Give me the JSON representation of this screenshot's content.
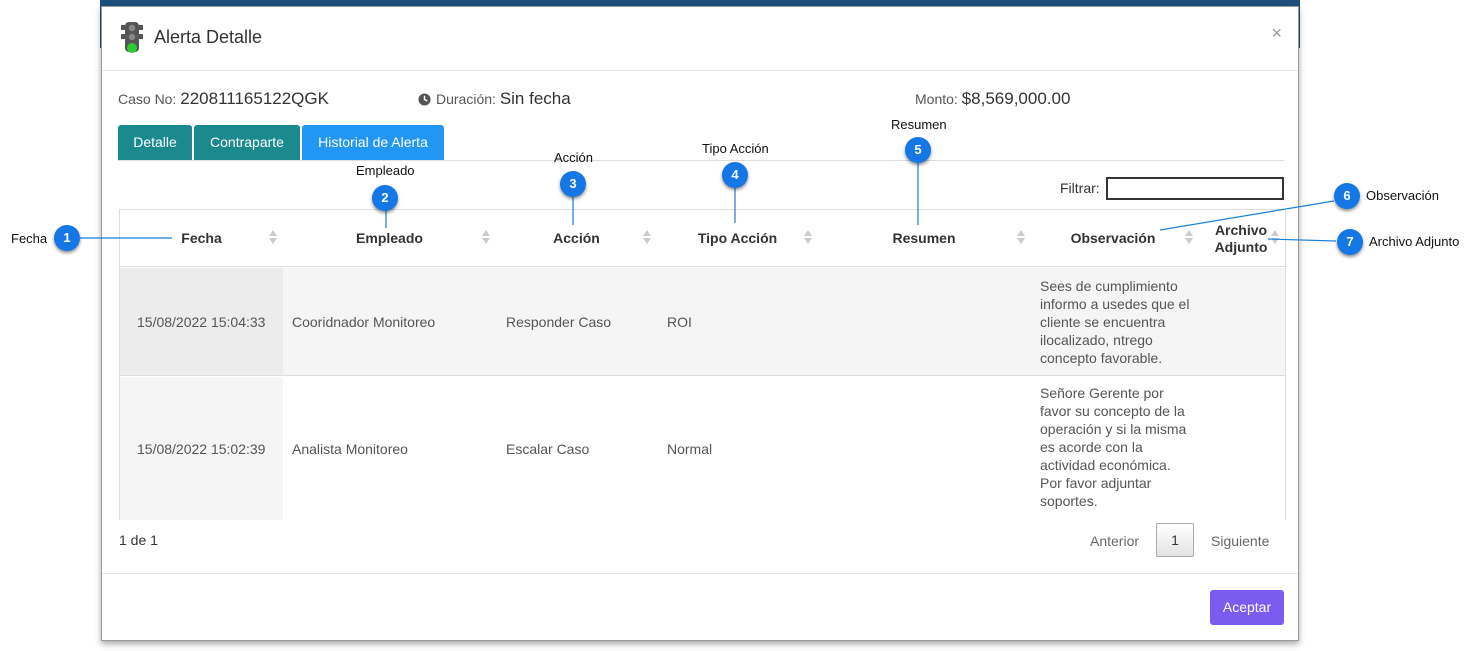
{
  "modal": {
    "title": "Alerta Detalle",
    "close": "×"
  },
  "info": {
    "case_label": "Caso No:",
    "case_value": "220811165122QGK",
    "duration_label": "Duración:",
    "duration_value": "Sin fecha",
    "amount_label": "Monto:",
    "amount_value": "$8,569,000.00"
  },
  "tabs": [
    {
      "label": "Detalle",
      "active": false
    },
    {
      "label": "Contraparte",
      "active": false
    },
    {
      "label": "Historial de Alerta",
      "active": true
    }
  ],
  "filter": {
    "label": "Filtrar:",
    "value": ""
  },
  "table": {
    "headers": [
      "Fecha",
      "Empleado",
      "Acción",
      "Tipo Acción",
      "Resumen",
      "Observación",
      "Archivo Adjunto"
    ],
    "rows": [
      {
        "fecha": "15/08/2022 15:04:33",
        "empleado": "Cooridnador Monitoreo",
        "accion": "Responder Caso",
        "tipo_accion": "ROI",
        "resumen": "",
        "observacion": "Sees de cumplimiento informo a usedes que el cliente se encuentra ilocalizado, ntrego concepto favorable.",
        "archivo": ""
      },
      {
        "fecha": "15/08/2022 15:02:39",
        "empleado": "Analista Monitoreo",
        "accion": "Escalar Caso",
        "tipo_accion": "Normal",
        "resumen": "",
        "observacion": "Señore Gerente por favor su concepto de la operación y si la misma es acorde con la actividad económica. Por favor adjuntar soportes.",
        "archivo": ""
      }
    ]
  },
  "pagination": {
    "info": "1 de 1",
    "prev": "Anterior",
    "page": "1",
    "next": "Siguiente"
  },
  "footer": {
    "accept": "Aceptar"
  },
  "annotations": [
    {
      "num": "1",
      "label": "Fecha"
    },
    {
      "num": "2",
      "label": "Empleado"
    },
    {
      "num": "3",
      "label": "Acción"
    },
    {
      "num": "4",
      "label": "Tipo Acción"
    },
    {
      "num": "5",
      "label": "Resumen"
    },
    {
      "num": "6",
      "label": "Observación"
    },
    {
      "num": "7",
      "label": "Archivo Adjunto"
    }
  ],
  "colors": {
    "tab": "#1b8a8f",
    "tab_active": "#2196f3",
    "accept": "#7c5cf0",
    "badge": "#1577e6"
  }
}
